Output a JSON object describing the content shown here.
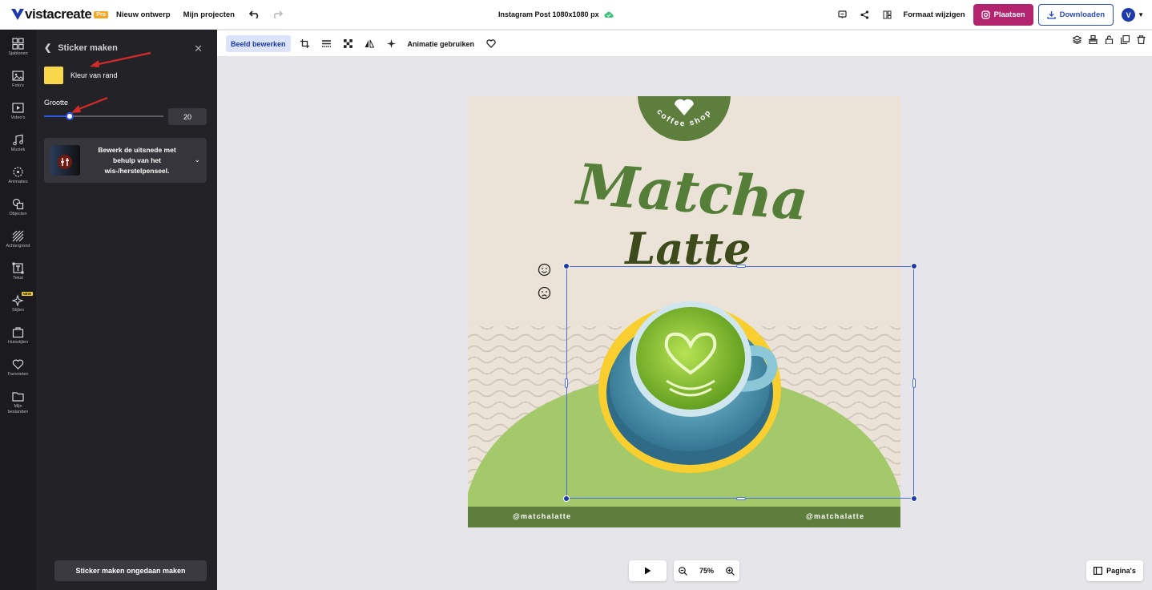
{
  "app": {
    "name": "vistacreate",
    "badge": "Pro"
  },
  "topnav": {
    "new_design": "Nieuw ontwerp",
    "my_projects": "Mijn projecten"
  },
  "document": {
    "title": "Instagram Post 1080x1080 px"
  },
  "top_actions": {
    "resize": "Formaat wijzigen",
    "post": "Plaatsen",
    "download": "Downloaden",
    "avatar_initial": "V"
  },
  "sidebar": {
    "items": [
      {
        "label": "Sjablonen",
        "icon": "templates-icon"
      },
      {
        "label": "Foto's",
        "icon": "photo-icon"
      },
      {
        "label": "Video's",
        "icon": "video-icon"
      },
      {
        "label": "Muziek",
        "icon": "music-icon"
      },
      {
        "label": "Animaties",
        "icon": "animation-icon"
      },
      {
        "label": "Objecten",
        "icon": "objects-icon"
      },
      {
        "label": "Achtergrond",
        "icon": "background-icon"
      },
      {
        "label": "Tekst",
        "icon": "text-icon"
      },
      {
        "label": "Stijlen",
        "icon": "styles-icon",
        "badge": "NEW"
      },
      {
        "label": "Huisstijlen",
        "icon": "brand-kit-icon"
      },
      {
        "label": "Favorieten",
        "icon": "heart-icon"
      },
      {
        "label": "Mijn bestanden",
        "icon": "folder-icon"
      }
    ]
  },
  "panel": {
    "title": "Sticker maken",
    "border_color_label": "Kleur van rand",
    "border_color": "#F8D84A",
    "size_label": "Grootte",
    "size_value": "20",
    "size_fraction": 0.215,
    "hint_text": "Bewerk de uitsnede met behulp van het wis-/herstelpenseel.",
    "undo_button": "Sticker maken ongedaan maken"
  },
  "context_toolbar": {
    "edit_image": "Beeld bewerken",
    "use_animation": "Animatie gebruiken"
  },
  "canvas": {
    "badge_text": "coffee shop",
    "headline": "Matcha",
    "subheadline": "Latte",
    "handle_left": "@matchalatte",
    "handle_right": "@matchalatte"
  },
  "zoom": {
    "level": "75%"
  },
  "pages": {
    "label": "Pagina's"
  },
  "colors": {
    "accent": "#1C3AA9",
    "post_button": "#B3246E",
    "green_dark": "#5E7E3E",
    "green_light": "#A3C96B",
    "sticker_border": "#F8D84A"
  }
}
